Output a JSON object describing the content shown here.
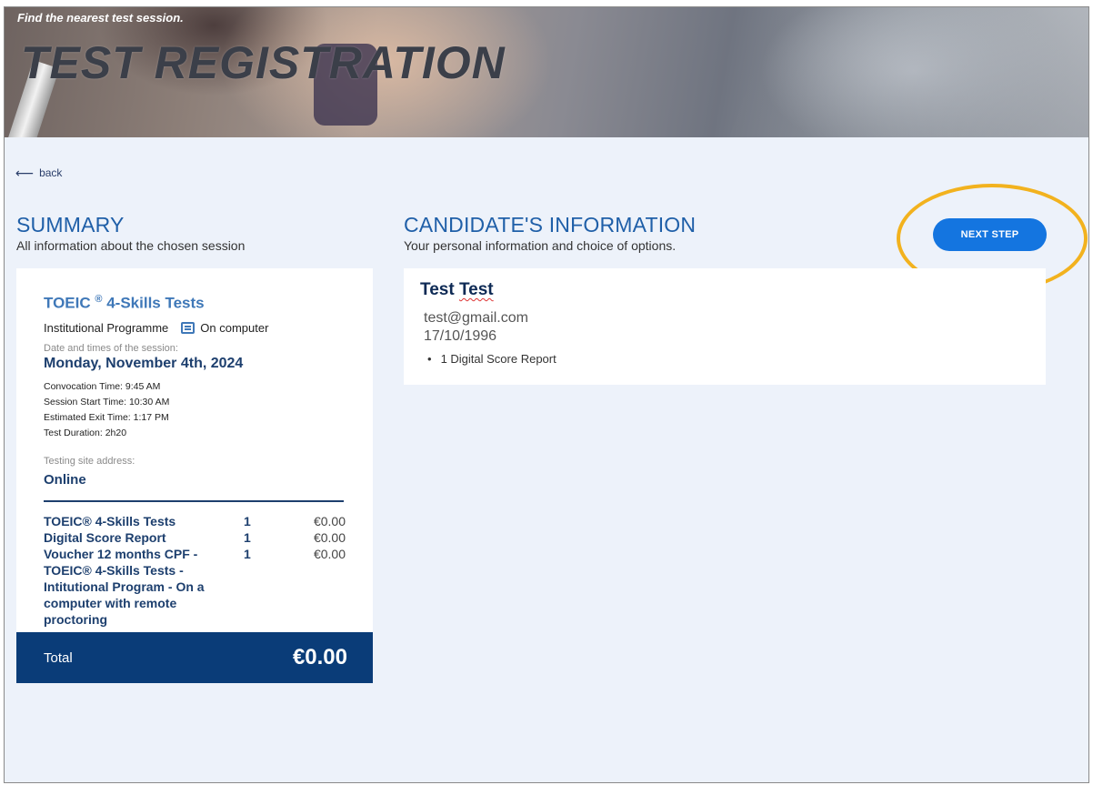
{
  "banner": {
    "subtitle": "Find the nearest test session.",
    "title": "TEST REGISTRATION"
  },
  "nav": {
    "back_label": "back",
    "back_icon": "arrow-left-icon"
  },
  "summary": {
    "heading": "SUMMARY",
    "subheading": "All information about the chosen session",
    "product_name": "TOEIC",
    "product_reg": "®",
    "product_suffix": "4-Skills Tests",
    "program": "Institutional Programme",
    "mode_icon": "computer-icon",
    "mode": "On computer",
    "date_label": "Date and times of the session:",
    "date_value": "Monday, November 4th, 2024",
    "times": [
      "Convocation Time: 9:45 AM",
      "Session Start Time: 10:30 AM",
      "Estimated Exit Time: 1:17 PM",
      "Test Duration: 2h20"
    ],
    "site_label": "Testing site address:",
    "site_value": "Online",
    "items": [
      {
        "name": "TOEIC® 4-Skills Tests",
        "qty": "1",
        "price": "€0.00"
      },
      {
        "name": "Digital Score Report",
        "qty": "1",
        "price": "€0.00"
      },
      {
        "name": "Voucher 12 months CPF - TOEIC® 4-Skills Tests - Intitutional Program - On a computer with remote proctoring",
        "qty": "1",
        "price": "€0.00"
      }
    ],
    "total_label": "Total",
    "total_value": "€0.00"
  },
  "candidate": {
    "heading": "CANDIDATE'S INFORMATION",
    "subheading": "Your personal information and choice of options.",
    "name_first": "Test",
    "name_last": "Test",
    "email": "test@gmail.com",
    "dob": "17/10/1996",
    "options": [
      "1 Digital Score Report"
    ]
  },
  "actions": {
    "next_label": "NEXT STEP"
  },
  "colors": {
    "accent_blue": "#1475e0",
    "navy": "#0a3c78",
    "heading_blue": "#1f5fa8",
    "highlight_yellow": "#f2b21e",
    "page_bg": "#edf2fa"
  }
}
